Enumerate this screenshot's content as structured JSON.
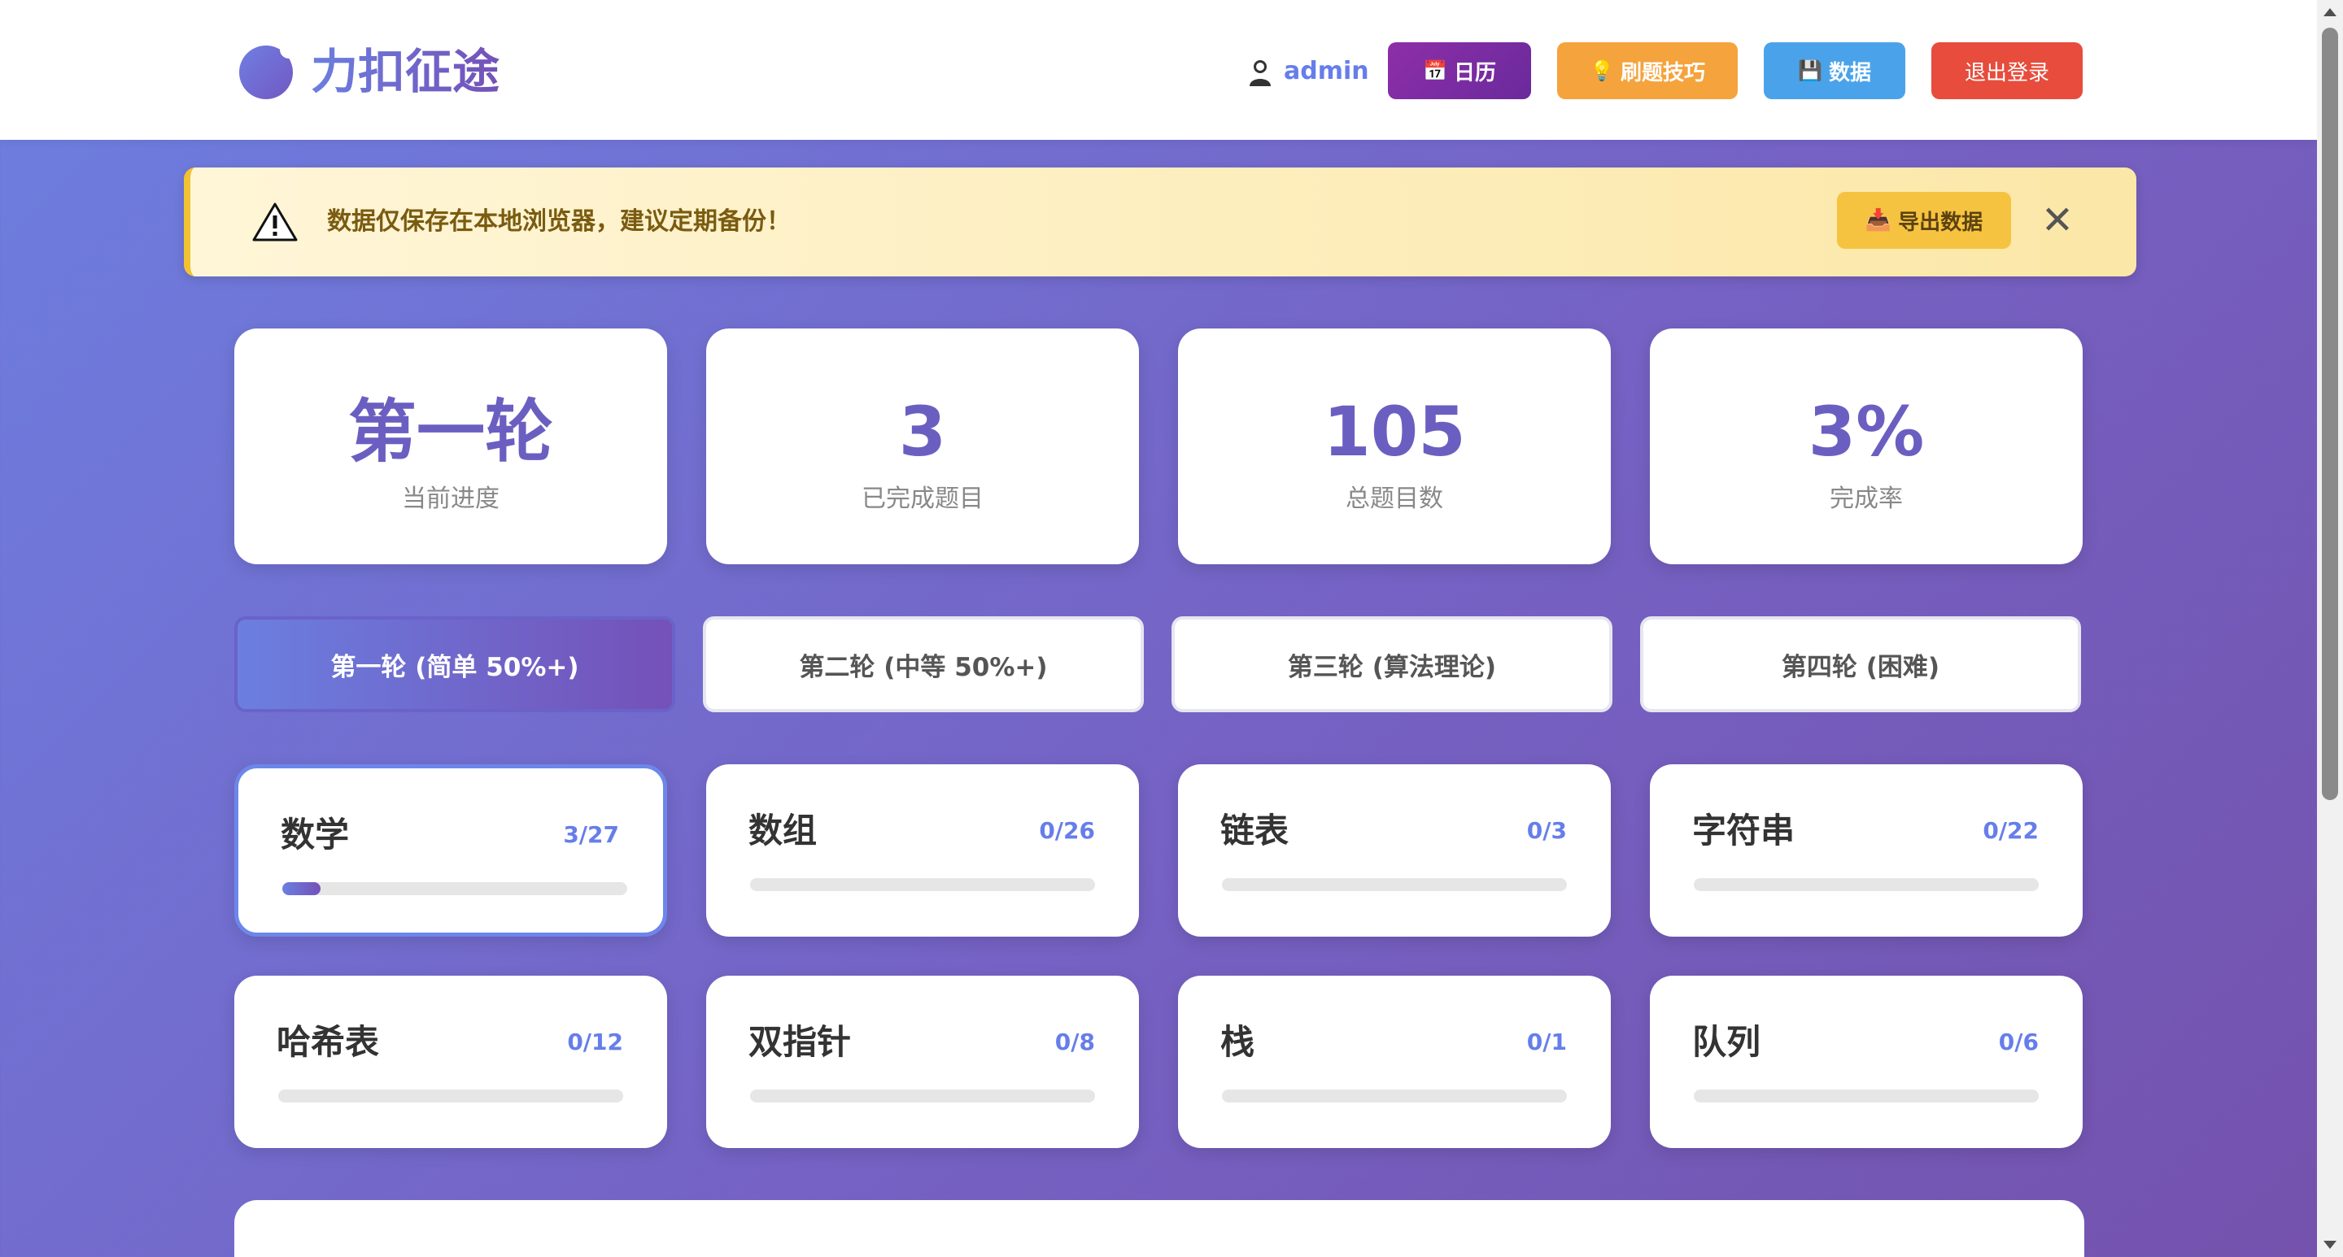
{
  "header": {
    "app_title": "力扣征途",
    "username": "admin",
    "buttons": {
      "calendar": "日历",
      "tips": "刷题技巧",
      "data": "数据",
      "logout": "退出登录"
    }
  },
  "banner": {
    "message": "数据仅保存在本地浏览器，建议定期备份！",
    "export_label": "导出数据",
    "close_symbol": "✕"
  },
  "stats": [
    {
      "value": "第一轮",
      "label": "当前进度"
    },
    {
      "value": "3",
      "label": "已完成题目"
    },
    {
      "value": "105",
      "label": "总题目数"
    },
    {
      "value": "3%",
      "label": "完成率"
    }
  ],
  "rounds": [
    {
      "label": "第一轮 (简单 50%+)",
      "active": true
    },
    {
      "label": "第二轮 (中等 50%+)",
      "active": false
    },
    {
      "label": "第三轮 (算法理论)",
      "active": false
    },
    {
      "label": "第四轮 (困难)",
      "active": false
    }
  ],
  "categories": [
    {
      "name": "数学",
      "count": "3/27",
      "done": 3,
      "total": 27
    },
    {
      "name": "数组",
      "count": "0/26",
      "done": 0,
      "total": 26
    },
    {
      "name": "链表",
      "count": "0/3",
      "done": 0,
      "total": 3
    },
    {
      "name": "字符串",
      "count": "0/22",
      "done": 0,
      "total": 22
    },
    {
      "name": "哈希表",
      "count": "0/12",
      "done": 0,
      "total": 12
    },
    {
      "name": "双指针",
      "count": "0/8",
      "done": 0,
      "total": 8
    },
    {
      "name": "栈",
      "count": "0/1",
      "done": 0,
      "total": 1
    },
    {
      "name": "队列",
      "count": "0/6",
      "done": 0,
      "total": 6
    }
  ],
  "colors": {
    "accent": "#667eea",
    "accent_dark": "#7451b8",
    "calendar_btn": "#8e2ea8",
    "tips_btn": "#f5a33c",
    "data_btn": "#4aa3ea",
    "logout_btn": "#e74c3c",
    "banner_bg": "#fff6d8",
    "export_btn": "#f6c340"
  },
  "icons": {
    "logo": "logo-circle-icon",
    "user": "user-icon",
    "calendar": "calendar-icon",
    "tips": "lightbulb-icon",
    "data": "floppy-disk-icon",
    "warning": "warning-triangle-icon",
    "export": "inbox-tray-icon",
    "close": "close-icon"
  }
}
